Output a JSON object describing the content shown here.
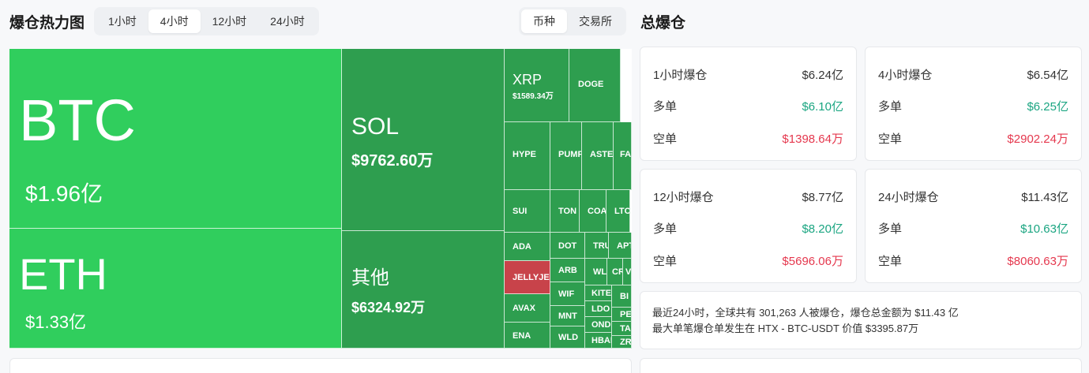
{
  "heatmap": {
    "title": "爆仓热力图",
    "time_tabs": [
      {
        "label": "1小时",
        "active": false
      },
      {
        "label": "4小时",
        "active": true
      },
      {
        "label": "12小时",
        "active": false
      },
      {
        "label": "24小时",
        "active": false
      }
    ],
    "view_tabs": [
      {
        "label": "币种",
        "active": true
      },
      {
        "label": "交易所",
        "active": false
      }
    ]
  },
  "colors": {
    "bright_green": "#30ce5d",
    "dark_green": "#2e9e4f",
    "red": "#c8434a",
    "long_green": "#1aa581",
    "short_red": "#e5384e"
  },
  "chart_data": {
    "type": "treemap",
    "tiles": [
      {
        "id": "btc",
        "label": "BTC",
        "value": "$1.96亿"
      },
      {
        "id": "eth",
        "label": "ETH",
        "value": "$1.33亿"
      },
      {
        "id": "sol",
        "label": "SOL",
        "value": "$9762.60万"
      },
      {
        "id": "other",
        "label": "其他",
        "value": "$6324.92万"
      },
      {
        "id": "xrp",
        "label": "XRP",
        "value": "$1589.34万"
      },
      {
        "id": "doge",
        "label": "DOGE"
      },
      {
        "id": "hype",
        "label": "HYPE"
      },
      {
        "id": "pump",
        "label": "PUMP"
      },
      {
        "id": "aster",
        "label": "ASTER"
      },
      {
        "id": "fa",
        "label": "FA"
      },
      {
        "id": "sui",
        "label": "SUI"
      },
      {
        "id": "ton",
        "label": "TON"
      },
      {
        "id": "coai",
        "label": "COAI"
      },
      {
        "id": "ltc",
        "label": "LTC"
      },
      {
        "id": "ada",
        "label": "ADA"
      },
      {
        "id": "dot",
        "label": "DOT"
      },
      {
        "id": "tru",
        "label": "TRU"
      },
      {
        "id": "apt",
        "label": "APT"
      },
      {
        "id": "jelly",
        "label": "JELLYJELLY"
      },
      {
        "id": "arb",
        "label": "ARB"
      },
      {
        "id": "wl",
        "label": "WL"
      },
      {
        "id": "cr",
        "label": "CR"
      },
      {
        "id": "v",
        "label": "V"
      },
      {
        "id": "wif",
        "label": "WIF"
      },
      {
        "id": "kite",
        "label": "KITE"
      },
      {
        "id": "avax",
        "label": "AVAX"
      },
      {
        "id": "mnt",
        "label": "MNT"
      },
      {
        "id": "ldo",
        "label": "LDO"
      },
      {
        "id": "bi",
        "label": "BI"
      },
      {
        "id": "pe",
        "label": "PE"
      },
      {
        "id": "ondo",
        "label": "ONDO"
      },
      {
        "id": "ta",
        "label": "TA"
      },
      {
        "id": "ena",
        "label": "ENA"
      },
      {
        "id": "wld",
        "label": "WLD"
      },
      {
        "id": "hbar",
        "label": "HBAR"
      },
      {
        "id": "zr",
        "label": "ZR"
      }
    ]
  },
  "liquidation": {
    "title": "总爆仓",
    "cards": [
      {
        "period": "1小时爆仓",
        "total": "$6.24亿",
        "long_label": "多单",
        "long": "$6.10亿",
        "short_label": "空单",
        "short": "$1398.64万"
      },
      {
        "period": "4小时爆仓",
        "total": "$6.54亿",
        "long_label": "多单",
        "long": "$6.25亿",
        "short_label": "空单",
        "short": "$2902.24万"
      },
      {
        "period": "12小时爆仓",
        "total": "$8.77亿",
        "long_label": "多单",
        "long": "$8.20亿",
        "short_label": "空单",
        "short": "$5696.06万"
      },
      {
        "period": "24小时爆仓",
        "total": "$11.43亿",
        "long_label": "多单",
        "long": "$10.63亿",
        "short_label": "空单",
        "short": "$8060.63万"
      }
    ],
    "summary_line1": "最近24小时，全球共有 301,263 人被爆仓，爆仓总金额为 $11.43 亿",
    "summary_line2": "最大单笔爆仓单发生在 HTX - BTC-USDT 价值 $3395.87万"
  }
}
